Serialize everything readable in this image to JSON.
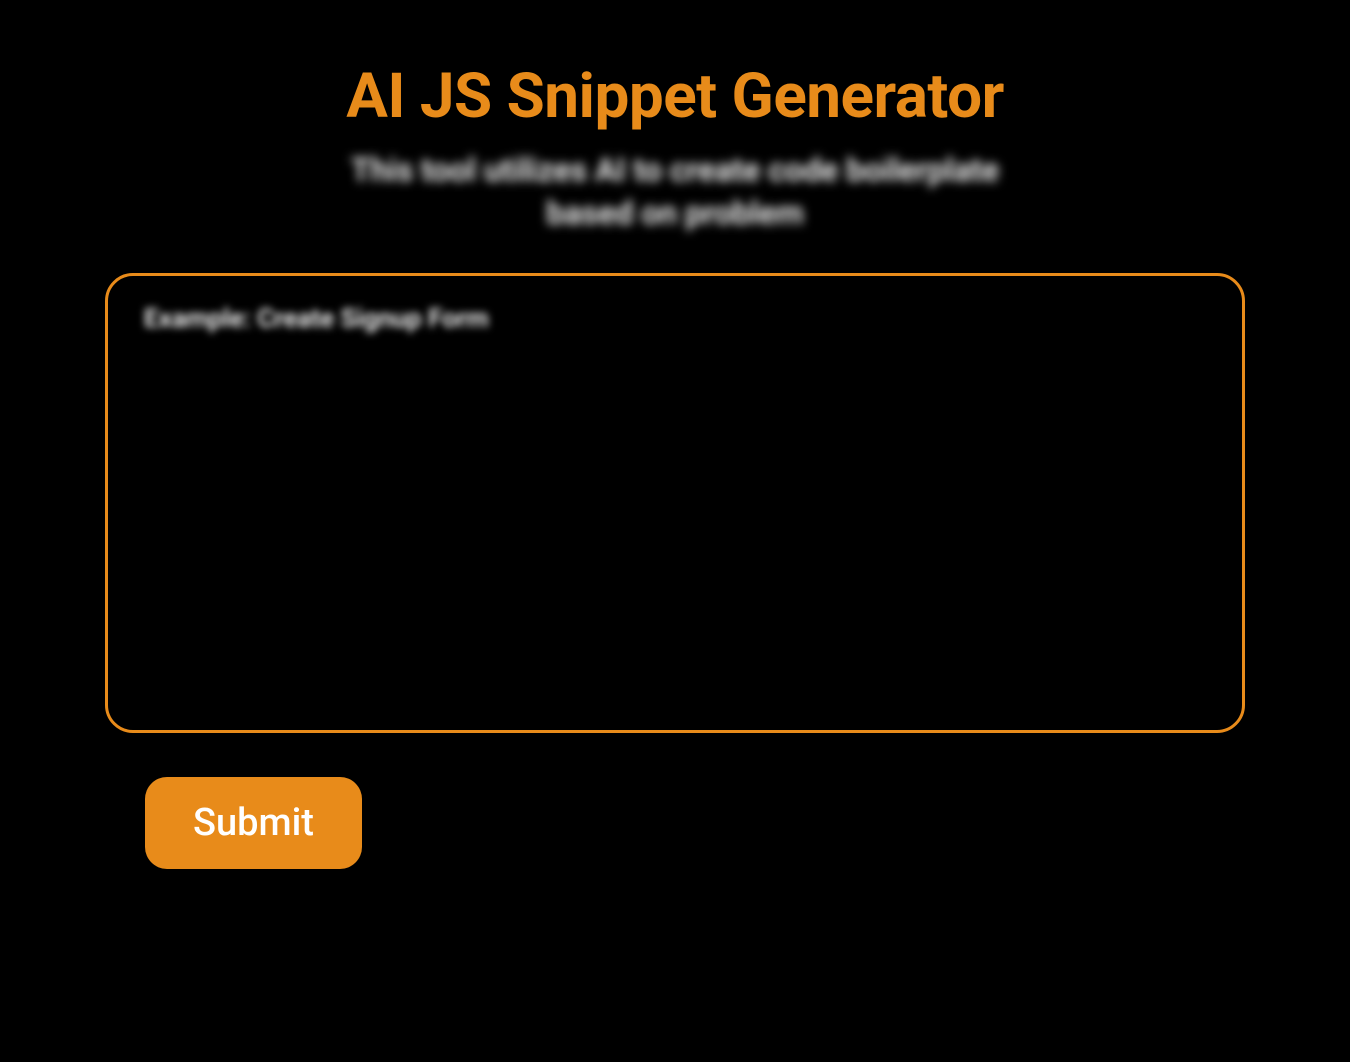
{
  "header": {
    "title": "AI JS Snippet Generator",
    "subtitle": "This tool utilizes AI to create code boilerplate based on problem"
  },
  "form": {
    "prompt_placeholder": "Example: Create Signup Form",
    "prompt_value": "",
    "submit_label": "Submit"
  },
  "colors": {
    "accent": "#E88B1A",
    "background": "#000000",
    "text": "#ffffff"
  }
}
